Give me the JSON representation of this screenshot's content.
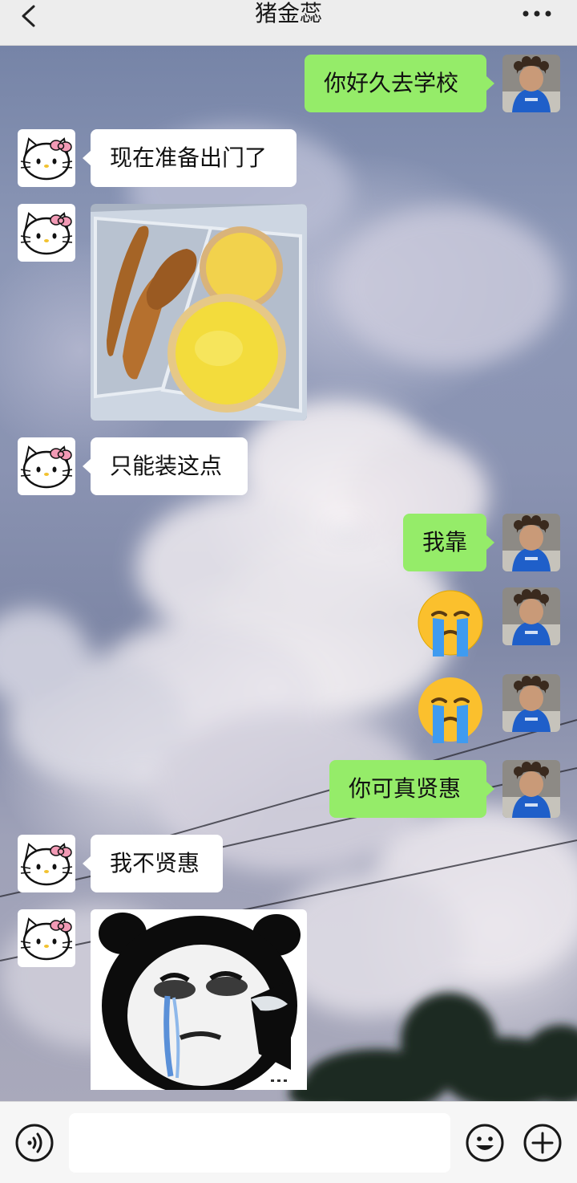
{
  "header": {
    "title": "猪金蕊",
    "back_icon": "chevron-left-icon",
    "more_icon": "more-dots-icon"
  },
  "messages": [
    {
      "side": "me",
      "type": "text",
      "text": "你好久去学校"
    },
    {
      "side": "other",
      "type": "text",
      "text": "现在准备出门了"
    },
    {
      "side": "other",
      "type": "image",
      "content": "photo of fried chicken strips and egg tarts in a lunch box"
    },
    {
      "side": "other",
      "type": "text",
      "text": "只能装这点"
    },
    {
      "side": "me",
      "type": "text",
      "text": "我靠"
    },
    {
      "side": "me",
      "type": "emoji",
      "emoji": "loudly-crying-face"
    },
    {
      "side": "me",
      "type": "emoji",
      "emoji": "loudly-crying-face"
    },
    {
      "side": "me",
      "type": "text",
      "text": "你可真贤惠"
    },
    {
      "side": "other",
      "type": "text",
      "text": "我不贤惠"
    },
    {
      "side": "other",
      "type": "image",
      "content": "crying panda-head meme sticker"
    }
  ],
  "avatars": {
    "me": "curly-hair-boy-blue-hoodie-avatar",
    "other": "hello-kitty-avatar"
  },
  "input_bar": {
    "voice_icon": "voice-icon",
    "input_value": "",
    "emoji_icon": "smile-icon",
    "plus_icon": "plus-circle-icon"
  },
  "colors": {
    "my_bubble": "#95ec69",
    "other_bubble": "#ffffff",
    "header_bg": "#ededed"
  }
}
